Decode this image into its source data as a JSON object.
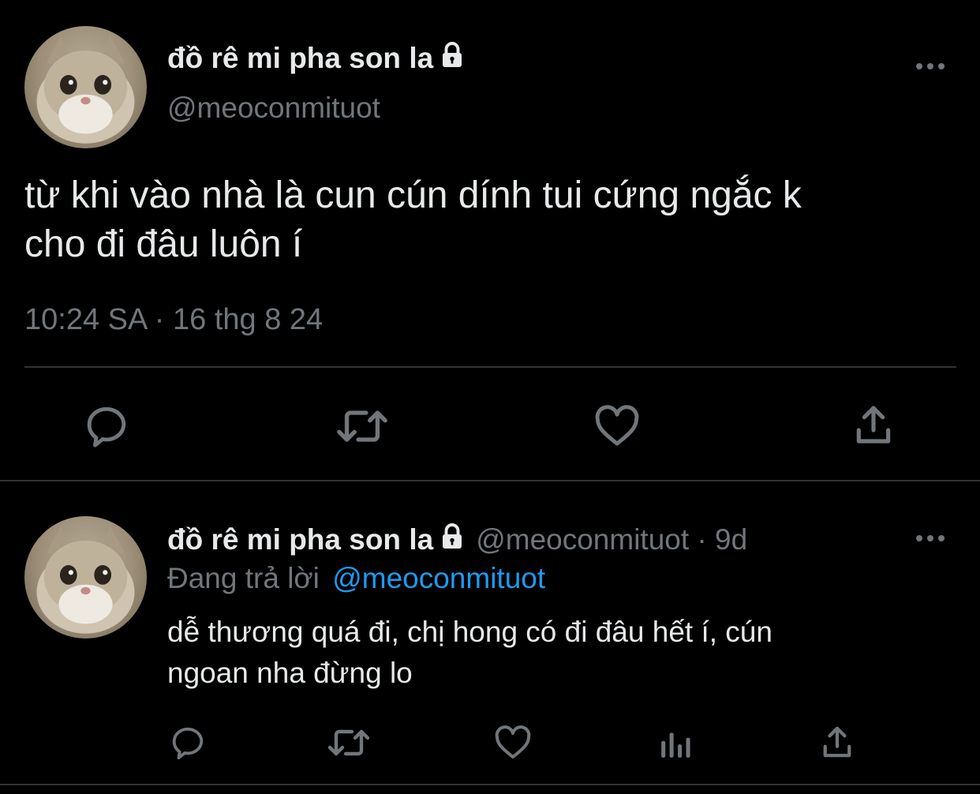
{
  "colors": {
    "background": "#000000",
    "text": "#e7e9ea",
    "muted": "#71767b",
    "accent": "#1d9bf0",
    "divider": "#2f3336"
  },
  "main_tweet": {
    "display_name": "đồ rê mi pha son la",
    "handle": "@meoconmituot",
    "text_line1": "từ khi vào nhà là cun cún dính tui cứng ngắc k",
    "text_line2": "cho đi đâu luôn í",
    "timestamp": "10:24 SA · 16 thg 8 24",
    "icons": {
      "lock": "lock-icon",
      "more": "more-icon",
      "reply": "reply-icon",
      "retweet": "retweet-icon",
      "like": "like-icon",
      "share": "share-icon"
    }
  },
  "reply_tweet": {
    "display_name": "đồ rê mi pha son la",
    "handle_time": "@meoconmituot · 9d",
    "replying_to_label": "Đang trả lời",
    "replying_to_handle": "@meoconmituot",
    "text_line1": "dễ thương quá đi, chị hong có đi đâu hết í, cún",
    "text_line2": "ngoan nha đừng lo",
    "icons": {
      "lock": "lock-icon",
      "more": "more-icon",
      "reply": "reply-icon",
      "retweet": "retweet-icon",
      "like": "like-icon",
      "views": "views-icon",
      "share": "share-icon"
    }
  }
}
